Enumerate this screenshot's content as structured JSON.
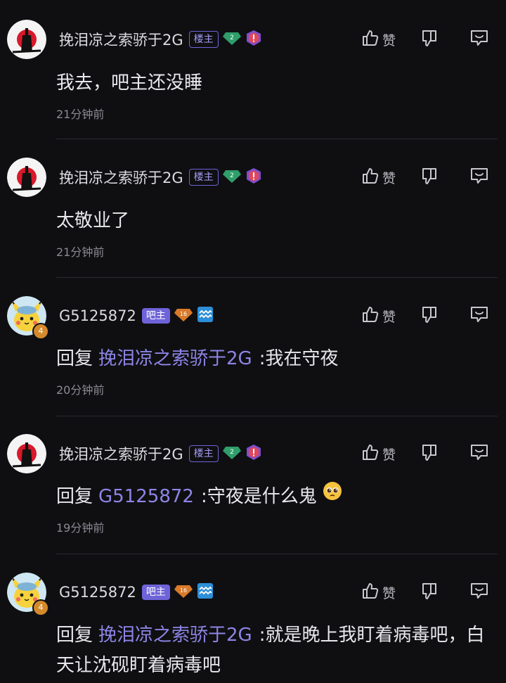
{
  "comments": [
    {
      "user": "挽泪凉之索骄于2G",
      "role": "楼主",
      "level": "2",
      "text": "我去，吧主还没睡",
      "time": "21分钟前",
      "like_label": "赞"
    },
    {
      "user": "挽泪凉之索骄于2G",
      "role": "楼主",
      "level": "2",
      "text": "太敬业了",
      "time": "21分钟前",
      "like_label": "赞"
    },
    {
      "user": "G5125872",
      "role": "吧主",
      "level": "16",
      "reply_prefix": "回复",
      "reply_target": "挽泪凉之索骄于2G",
      "text": ":我在守夜",
      "time": "20分钟前",
      "like_label": "赞",
      "avatar_badge": "4"
    },
    {
      "user": "挽泪凉之索骄于2G",
      "role": "楼主",
      "level": "2",
      "reply_prefix": "回复",
      "reply_target": "G5125872",
      "text": ":守夜是什么鬼",
      "time": "19分钟前",
      "like_label": "赞"
    },
    {
      "user": "G5125872",
      "role": "吧主",
      "level": "16",
      "reply_prefix": "回复",
      "reply_target": "挽泪凉之索骄于2G",
      "text": ":就是晚上我盯着病毒吧，白天让沈砚盯着病毒吧",
      "like_label": "赞",
      "avatar_badge": "4"
    }
  ],
  "colors": {
    "background": "#0f0f12",
    "accent": "#8d85e6",
    "badge_purple": "#6e63d8",
    "level_green": "#2f9e6a",
    "level_orange": "#d97a2a"
  },
  "icons": [
    "like-icon",
    "dislike-icon",
    "reply-icon",
    "level-gem-icon",
    "warning-badge-icon",
    "aquarius-icon",
    "pleading-face-emoji"
  ]
}
